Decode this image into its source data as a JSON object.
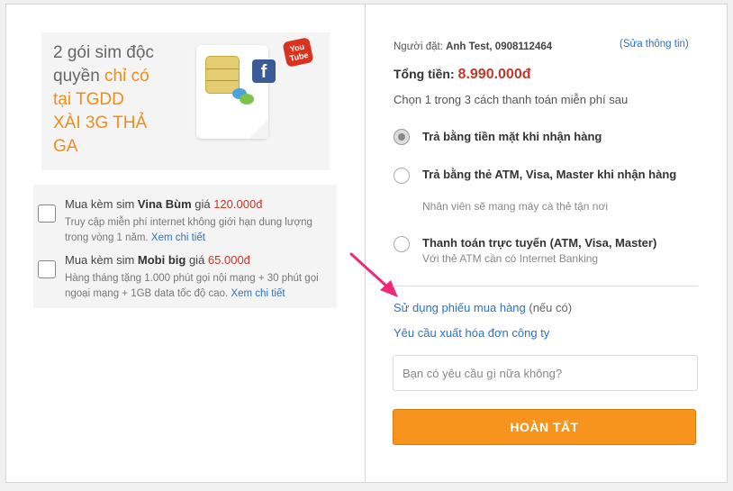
{
  "promo": {
    "line1": "2 gói sim độc",
    "line2a": "quyền ",
    "line2b": "chỉ có",
    "line3": "tại TGDD",
    "line4": "XÀI 3G THẢ",
    "line5": "GA",
    "youtube_text": "You Tube",
    "facebook_text": "f"
  },
  "addons": [
    {
      "prefix": "Mua kèm sim ",
      "name": "Vina Bùm",
      "mid": " giá ",
      "price": "120.000đ",
      "desc": "Truy cập miễn phí internet không giới hạn dung lượng trong vòng 1 năm. ",
      "link": "Xem chi tiết"
    },
    {
      "prefix": "Mua kèm sim ",
      "name": "Mobi big",
      "mid": " giá ",
      "price": "65.000đ",
      "desc": "Hàng tháng tặng 1.000 phút gọi nội mạng + 30 phút gọi ngoại mạng + 1GB data tốc độ cao. ",
      "link": "Xem chi tiết"
    }
  ],
  "order": {
    "buyer_label": "Người đặt: ",
    "buyer_value": "Anh Test, 0908112464",
    "edit_link": "(Sửa thông tin)",
    "total_label": "Tổng tiền: ",
    "total_value": "8.990.000đ",
    "choose_text": "Chọn 1 trong 3 cách thanh toán miễn phí sau"
  },
  "payment_options": [
    {
      "title": "Trả bằng tiền mặt khi nhận hàng",
      "subtitle": "",
      "selected": true
    },
    {
      "title": "Trả bằng thẻ ATM, Visa, Master khi nhận hàng",
      "subtitle": "Nhân viên sẽ mang máy cà thẻ tận nơi",
      "selected": false
    },
    {
      "title": "Thanh toán trực tuyến (ATM, Visa, Master)",
      "subtitle": "Với thẻ ATM cần có Internet Banking",
      "selected": false
    }
  ],
  "voucher": {
    "link": "Sử dụng phiếu mua hàng",
    "note": " (nếu có)"
  },
  "invoice_link": "Yêu cầu xuất hóa đơn công ty",
  "request_input": {
    "placeholder": "Bạn có yêu cầu gì nữa không?",
    "value": ""
  },
  "submit_label": "HOÀN TẤT",
  "colors": {
    "accent": "#f7941d",
    "price": "#c0392b",
    "link": "#2a72c8",
    "arrow": "#f0287a"
  }
}
